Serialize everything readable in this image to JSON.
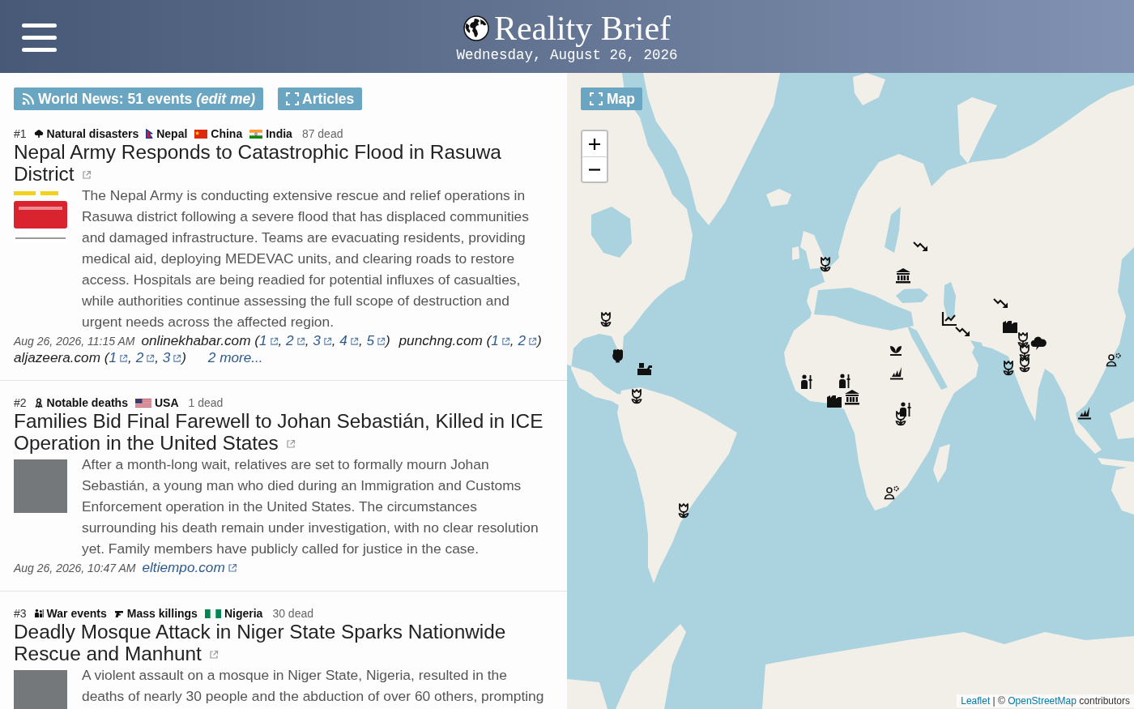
{
  "header": {
    "title": "Reality Brief",
    "date": "Wednesday, August 26, 2026"
  },
  "toolbar": {
    "feed_button": "World News: 51 events *(edit me)*",
    "articles_button": "Articles"
  },
  "articles": [
    {
      "number": "#1",
      "tags": [
        {
          "kind": "disaster",
          "label": "Natural disasters"
        }
      ],
      "countries": [
        {
          "kind": "np",
          "name": "Nepal"
        },
        {
          "kind": "cn",
          "name": "China"
        },
        {
          "kind": "in",
          "name": "India"
        }
      ],
      "casualties": "87 dead",
      "title": "Nepal Army Responds to Catastrophic Flood in Rasuwa District",
      "thumbnail": {
        "kind": "logo"
      },
      "summary": "The Nepal Army is conducting extensive rescue and relief operations in Rasuwa district following a severe flood that has displaced communities and damaged infrastructure. Teams are evacuating residents, providing medical aid, deploying MEDEVAC units, and clearing roads to restore access. Hospitals are being readied for potential influxes of casualties, while authorities continue assessing the full scope of destruction and urgent needs across the affected region.",
      "timestamp": "Aug 26, 2026, 11:15 AM",
      "sources": [
        {
          "kind": "grouped",
          "domain": "onlinekhabar.com",
          "open": "(",
          "links": [
            "1",
            "2",
            "3",
            "4",
            "5"
          ],
          "separator": ",",
          "close": ")"
        },
        {
          "kind": "grouped",
          "domain": "punchng.com",
          "open": "(",
          "links": [
            "1",
            "2"
          ],
          "separator": ",",
          "close": ")"
        },
        {
          "kind": "grouped",
          "domain": "aljazeera.com",
          "open": "(",
          "links": [
            "1",
            "2",
            "3"
          ],
          "separator": ",",
          "close": ")"
        }
      ],
      "more": "2 more..."
    },
    {
      "number": "#2",
      "tags": [
        {
          "kind": "death",
          "label": "Notable deaths"
        }
      ],
      "countries": [
        {
          "kind": "us",
          "name": "USA"
        }
      ],
      "casualties": "1 dead",
      "title": "Families Bid Final Farewell to Johan Sebastián, Killed in ICE Operation in the United States",
      "thumbnail": {
        "kind": "photo"
      },
      "summary": "After a month-long wait, relatives are set to formally mourn Johan Sebastián, a young man who died during an Immigration and Customs Enforcement operation in the United States. The circumstances surrounding his death remain under investigation, with no clear resolution yet. Family members have publicly called for justice in the case.",
      "timestamp": "Aug 26, 2026, 10:47 AM",
      "sources": [
        {
          "kind": "single",
          "domain": "eltiempo.com"
        }
      ]
    },
    {
      "number": "#3",
      "tags": [
        {
          "kind": "war",
          "label": "War events"
        },
        {
          "kind": "killing",
          "label": "Mass killings"
        }
      ],
      "countries": [
        {
          "kind": "ng",
          "name": "Nigeria"
        }
      ],
      "casualties": "30 dead",
      "title": "Deadly Mosque Attack in Niger State Sparks Nationwide Rescue and Manhunt",
      "thumbnail": {
        "kind": "photo"
      },
      "summary": "A violent assault on a mosque in Niger State, Nigeria, resulted in the deaths of nearly 30 people and the abduction of over 60 others, prompting"
    }
  ],
  "map": {
    "button": "Map",
    "attribution": [
      {
        "kind": "link",
        "text": "Leaflet"
      },
      {
        "kind": "text",
        "text": "| ©"
      },
      {
        "kind": "link",
        "text": "OpenStreetMap"
      },
      {
        "kind": "text",
        "text": "contributors"
      }
    ]
  }
}
